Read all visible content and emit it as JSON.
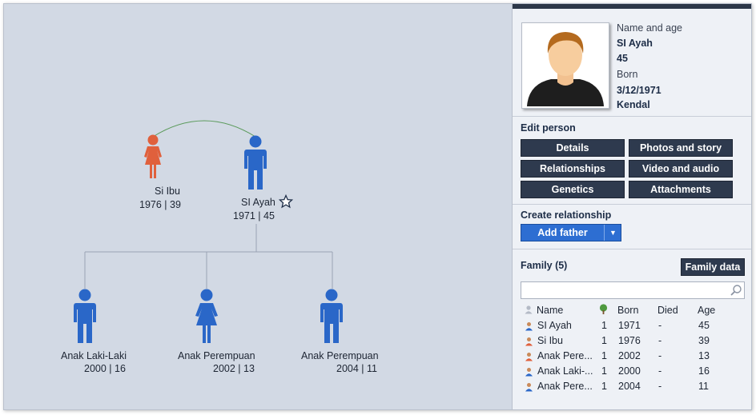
{
  "tree": {
    "people": [
      {
        "id": "mother",
        "name": "Si Ibu",
        "dates": "1976 | 39",
        "gender": "female",
        "color": "#e0603c"
      },
      {
        "id": "father",
        "name": "SI Ayah",
        "dates": "1971 | 45",
        "gender": "male",
        "color": "#2a67c8",
        "starred": true
      },
      {
        "id": "child1",
        "name": "Anak Laki-Laki",
        "dates": "2000 | 16",
        "gender": "male",
        "color": "#2a67c8"
      },
      {
        "id": "child2",
        "name": "Anak Perempuan",
        "dates": "2002 | 13",
        "gender": "female",
        "color": "#2a67c8"
      },
      {
        "id": "child3",
        "name": "Anak Perempuan",
        "dates": "2004 | 11",
        "gender": "male",
        "color": "#2a67c8"
      }
    ]
  },
  "profile": {
    "name_label": "Name and age",
    "name": "SI Ayah",
    "age": "45",
    "born_label": "Born",
    "born_date": "3/12/1971",
    "born_place": "Kendal"
  },
  "edit_person": {
    "title": "Edit person",
    "buttons": [
      "Details",
      "Photos and story",
      "Relationships",
      "Video and audio",
      "Genetics",
      "Attachments"
    ]
  },
  "create_relationship": {
    "title": "Create relationship",
    "add_button": "Add father",
    "dropdown_glyph": "▼"
  },
  "family": {
    "title": "Family (5)",
    "family_data_button": "Family data",
    "search_placeholder": "",
    "headers": [
      "Name",
      "",
      "Born",
      "Died",
      "Age"
    ],
    "rows": [
      {
        "name": "SI Ayah",
        "count": "1",
        "born": "1971",
        "died": "-",
        "age": "45",
        "gender": "male"
      },
      {
        "name": "Si  Ibu",
        "count": "1",
        "born": "1976",
        "died": "-",
        "age": "39",
        "gender": "female"
      },
      {
        "name": "Anak Pere...",
        "count": "1",
        "born": "2002",
        "died": "-",
        "age": "13",
        "gender": "female"
      },
      {
        "name": "Anak Laki-...",
        "count": "1",
        "born": "2000",
        "died": "-",
        "age": "16",
        "gender": "male"
      },
      {
        "name": "Anak Pere...",
        "count": "1",
        "born": "2004",
        "died": "-",
        "age": "11",
        "gender": "male"
      }
    ]
  },
  "colors": {
    "male": "#2a67c8",
    "female": "#e0603c",
    "panel_dark": "#2e3a4e",
    "accent": "#2d6ed2"
  }
}
